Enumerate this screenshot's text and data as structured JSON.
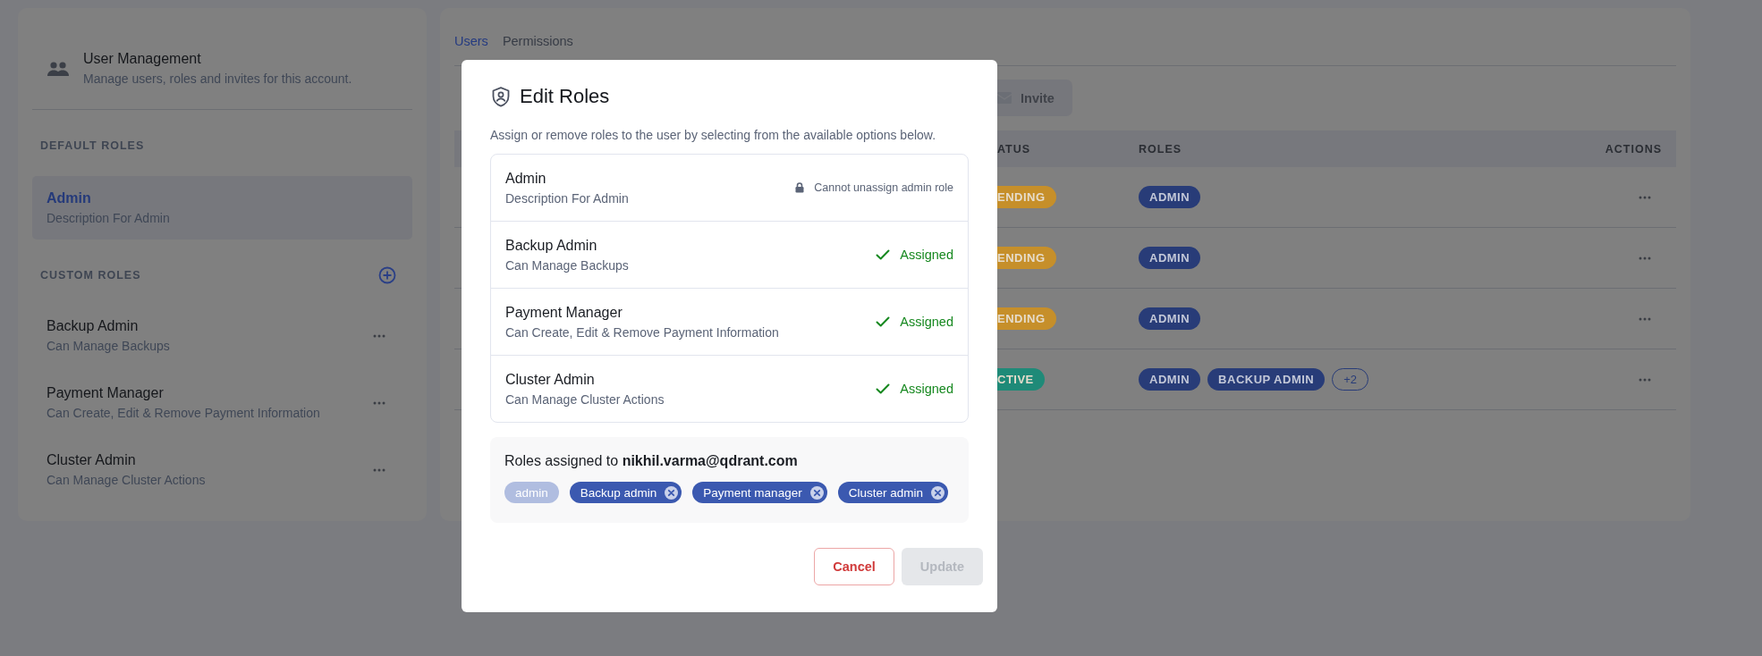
{
  "sidebar": {
    "title": "User Management",
    "subtitle": "Manage users, roles and invites for this account.",
    "default_heading": "DEFAULT ROLES",
    "default_roles": [
      {
        "name": "Admin",
        "description": "Description For Admin",
        "selected": true
      }
    ],
    "custom_heading": "CUSTOM ROLES",
    "custom_roles": [
      {
        "name": "Backup Admin",
        "description": "Can Manage Backups",
        "selected": false
      },
      {
        "name": "Payment Manager",
        "description": "Can Create, Edit & Remove Payment Information",
        "selected": false
      },
      {
        "name": "Cluster Admin",
        "description": "Can Manage Cluster Actions",
        "selected": false
      }
    ]
  },
  "main": {
    "tabs": [
      {
        "label": "Users",
        "selected": true
      },
      {
        "label": "Permissions",
        "selected": false
      }
    ],
    "invite_button": "Invite",
    "table": {
      "columns": [
        "ATUS",
        "ROLES",
        "ACTIONS"
      ],
      "rows": [
        {
          "status": "ENDING",
          "color": "#c68f2a",
          "roles": [
            "ADMIN"
          ]
        },
        {
          "status": "ENDING",
          "color": "#c68f2a",
          "roles": [
            "ADMIN"
          ]
        },
        {
          "status": "ENDING",
          "color": "#c68f2a",
          "roles": [
            "ADMIN"
          ]
        },
        {
          "status": "CTIVE",
          "color": "#1f8a78",
          "roles": [
            "ADMIN",
            "BACKUP ADMIN"
          ],
          "more": "+2"
        }
      ]
    }
  },
  "dialog": {
    "title": "Edit Roles",
    "description": "Assign or remove roles to the user by selecting from the available options below.",
    "roles": [
      {
        "name": "Admin",
        "description": "Description For Admin",
        "kind": "locked",
        "status": "Cannot unassign admin role"
      },
      {
        "name": "Backup Admin",
        "description": "Can Manage Backups",
        "kind": "assigned",
        "status": "Assigned"
      },
      {
        "name": "Payment Manager",
        "description": "Can Create, Edit & Remove Payment Information",
        "kind": "assigned",
        "status": "Assigned"
      },
      {
        "name": "Cluster Admin",
        "description": "Can Manage Cluster Actions",
        "kind": "assigned",
        "status": "Assigned"
      }
    ],
    "summary": "Roles assigned to **nikhil.varma@qdrant.com**",
    "chips": [
      {
        "label": "admin",
        "removable": false
      },
      {
        "label": "Backup admin",
        "removable": true
      },
      {
        "label": "Payment manager",
        "removable": true
      },
      {
        "label": "Cluster admin",
        "removable": true
      }
    ],
    "buttons": [
      {
        "label": "Cancel",
        "kind": "cancel",
        "disabled": false
      },
      {
        "label": "Update",
        "kind": "primary",
        "disabled": true
      }
    ]
  }
}
